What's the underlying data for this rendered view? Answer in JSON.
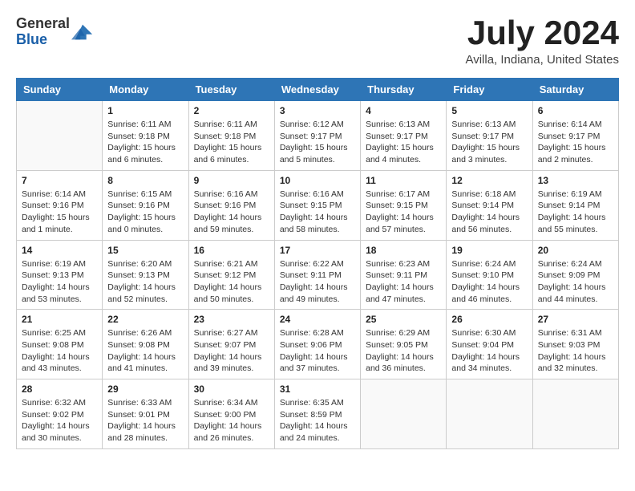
{
  "header": {
    "logo_general": "General",
    "logo_blue": "Blue",
    "month_title": "July 2024",
    "location": "Avilla, Indiana, United States"
  },
  "calendar": {
    "days_of_week": [
      "Sunday",
      "Monday",
      "Tuesday",
      "Wednesday",
      "Thursday",
      "Friday",
      "Saturday"
    ],
    "weeks": [
      [
        {
          "day": "",
          "sunrise": "",
          "sunset": "",
          "daylight": ""
        },
        {
          "day": "1",
          "sunrise": "Sunrise: 6:11 AM",
          "sunset": "Sunset: 9:18 PM",
          "daylight": "Daylight: 15 hours and 6 minutes."
        },
        {
          "day": "2",
          "sunrise": "Sunrise: 6:11 AM",
          "sunset": "Sunset: 9:18 PM",
          "daylight": "Daylight: 15 hours and 6 minutes."
        },
        {
          "day": "3",
          "sunrise": "Sunrise: 6:12 AM",
          "sunset": "Sunset: 9:17 PM",
          "daylight": "Daylight: 15 hours and 5 minutes."
        },
        {
          "day": "4",
          "sunrise": "Sunrise: 6:13 AM",
          "sunset": "Sunset: 9:17 PM",
          "daylight": "Daylight: 15 hours and 4 minutes."
        },
        {
          "day": "5",
          "sunrise": "Sunrise: 6:13 AM",
          "sunset": "Sunset: 9:17 PM",
          "daylight": "Daylight: 15 hours and 3 minutes."
        },
        {
          "day": "6",
          "sunrise": "Sunrise: 6:14 AM",
          "sunset": "Sunset: 9:17 PM",
          "daylight": "Daylight: 15 hours and 2 minutes."
        }
      ],
      [
        {
          "day": "7",
          "sunrise": "Sunrise: 6:14 AM",
          "sunset": "Sunset: 9:16 PM",
          "daylight": "Daylight: 15 hours and 1 minute."
        },
        {
          "day": "8",
          "sunrise": "Sunrise: 6:15 AM",
          "sunset": "Sunset: 9:16 PM",
          "daylight": "Daylight: 15 hours and 0 minutes."
        },
        {
          "day": "9",
          "sunrise": "Sunrise: 6:16 AM",
          "sunset": "Sunset: 9:16 PM",
          "daylight": "Daylight: 14 hours and 59 minutes."
        },
        {
          "day": "10",
          "sunrise": "Sunrise: 6:16 AM",
          "sunset": "Sunset: 9:15 PM",
          "daylight": "Daylight: 14 hours and 58 minutes."
        },
        {
          "day": "11",
          "sunrise": "Sunrise: 6:17 AM",
          "sunset": "Sunset: 9:15 PM",
          "daylight": "Daylight: 14 hours and 57 minutes."
        },
        {
          "day": "12",
          "sunrise": "Sunrise: 6:18 AM",
          "sunset": "Sunset: 9:14 PM",
          "daylight": "Daylight: 14 hours and 56 minutes."
        },
        {
          "day": "13",
          "sunrise": "Sunrise: 6:19 AM",
          "sunset": "Sunset: 9:14 PM",
          "daylight": "Daylight: 14 hours and 55 minutes."
        }
      ],
      [
        {
          "day": "14",
          "sunrise": "Sunrise: 6:19 AM",
          "sunset": "Sunset: 9:13 PM",
          "daylight": "Daylight: 14 hours and 53 minutes."
        },
        {
          "day": "15",
          "sunrise": "Sunrise: 6:20 AM",
          "sunset": "Sunset: 9:13 PM",
          "daylight": "Daylight: 14 hours and 52 minutes."
        },
        {
          "day": "16",
          "sunrise": "Sunrise: 6:21 AM",
          "sunset": "Sunset: 9:12 PM",
          "daylight": "Daylight: 14 hours and 50 minutes."
        },
        {
          "day": "17",
          "sunrise": "Sunrise: 6:22 AM",
          "sunset": "Sunset: 9:11 PM",
          "daylight": "Daylight: 14 hours and 49 minutes."
        },
        {
          "day": "18",
          "sunrise": "Sunrise: 6:23 AM",
          "sunset": "Sunset: 9:11 PM",
          "daylight": "Daylight: 14 hours and 47 minutes."
        },
        {
          "day": "19",
          "sunrise": "Sunrise: 6:24 AM",
          "sunset": "Sunset: 9:10 PM",
          "daylight": "Daylight: 14 hours and 46 minutes."
        },
        {
          "day": "20",
          "sunrise": "Sunrise: 6:24 AM",
          "sunset": "Sunset: 9:09 PM",
          "daylight": "Daylight: 14 hours and 44 minutes."
        }
      ],
      [
        {
          "day": "21",
          "sunrise": "Sunrise: 6:25 AM",
          "sunset": "Sunset: 9:08 PM",
          "daylight": "Daylight: 14 hours and 43 minutes."
        },
        {
          "day": "22",
          "sunrise": "Sunrise: 6:26 AM",
          "sunset": "Sunset: 9:08 PM",
          "daylight": "Daylight: 14 hours and 41 minutes."
        },
        {
          "day": "23",
          "sunrise": "Sunrise: 6:27 AM",
          "sunset": "Sunset: 9:07 PM",
          "daylight": "Daylight: 14 hours and 39 minutes."
        },
        {
          "day": "24",
          "sunrise": "Sunrise: 6:28 AM",
          "sunset": "Sunset: 9:06 PM",
          "daylight": "Daylight: 14 hours and 37 minutes."
        },
        {
          "day": "25",
          "sunrise": "Sunrise: 6:29 AM",
          "sunset": "Sunset: 9:05 PM",
          "daylight": "Daylight: 14 hours and 36 minutes."
        },
        {
          "day": "26",
          "sunrise": "Sunrise: 6:30 AM",
          "sunset": "Sunset: 9:04 PM",
          "daylight": "Daylight: 14 hours and 34 minutes."
        },
        {
          "day": "27",
          "sunrise": "Sunrise: 6:31 AM",
          "sunset": "Sunset: 9:03 PM",
          "daylight": "Daylight: 14 hours and 32 minutes."
        }
      ],
      [
        {
          "day": "28",
          "sunrise": "Sunrise: 6:32 AM",
          "sunset": "Sunset: 9:02 PM",
          "daylight": "Daylight: 14 hours and 30 minutes."
        },
        {
          "day": "29",
          "sunrise": "Sunrise: 6:33 AM",
          "sunset": "Sunset: 9:01 PM",
          "daylight": "Daylight: 14 hours and 28 minutes."
        },
        {
          "day": "30",
          "sunrise": "Sunrise: 6:34 AM",
          "sunset": "Sunset: 9:00 PM",
          "daylight": "Daylight: 14 hours and 26 minutes."
        },
        {
          "day": "31",
          "sunrise": "Sunrise: 6:35 AM",
          "sunset": "Sunset: 8:59 PM",
          "daylight": "Daylight: 14 hours and 24 minutes."
        },
        {
          "day": "",
          "sunrise": "",
          "sunset": "",
          "daylight": ""
        },
        {
          "day": "",
          "sunrise": "",
          "sunset": "",
          "daylight": ""
        },
        {
          "day": "",
          "sunrise": "",
          "sunset": "",
          "daylight": ""
        }
      ]
    ]
  }
}
